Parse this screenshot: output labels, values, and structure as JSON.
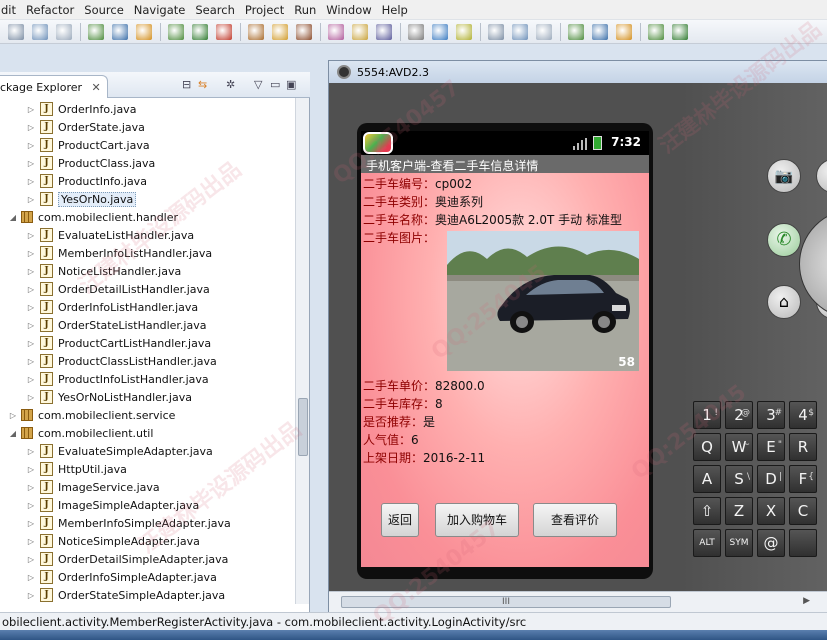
{
  "menu": [
    "dit",
    "Refactor",
    "Source",
    "Navigate",
    "Search",
    "Project",
    "Run",
    "Window",
    "Help"
  ],
  "explorer": {
    "tab_label": "ckage Explorer",
    "close": "✕",
    "tree": [
      {
        "type": "file",
        "name": "OrderInfo.java",
        "indent": 1
      },
      {
        "type": "file",
        "name": "OrderState.java",
        "indent": 1
      },
      {
        "type": "file",
        "name": "ProductCart.java",
        "indent": 1
      },
      {
        "type": "file",
        "name": "ProductClass.java",
        "indent": 1
      },
      {
        "type": "file",
        "name": "ProductInfo.java",
        "indent": 1
      },
      {
        "type": "file",
        "name": "YesOrNo.java",
        "indent": 1,
        "selected": true
      },
      {
        "type": "package",
        "name": "com.mobileclient.handler",
        "indent": 0,
        "expanded": true
      },
      {
        "type": "file",
        "name": "EvaluateListHandler.java",
        "indent": 1
      },
      {
        "type": "file",
        "name": "MemberInfoListHandler.java",
        "indent": 1
      },
      {
        "type": "file",
        "name": "NoticeListHandler.java",
        "indent": 1
      },
      {
        "type": "file",
        "name": "OrderDetailListHandler.java",
        "indent": 1
      },
      {
        "type": "file",
        "name": "OrderInfoListHandler.java",
        "indent": 1
      },
      {
        "type": "file",
        "name": "OrderStateListHandler.java",
        "indent": 1
      },
      {
        "type": "file",
        "name": "ProductCartListHandler.java",
        "indent": 1
      },
      {
        "type": "file",
        "name": "ProductClassListHandler.java",
        "indent": 1
      },
      {
        "type": "file",
        "name": "ProductInfoListHandler.java",
        "indent": 1
      },
      {
        "type": "file",
        "name": "YesOrNoListHandler.java",
        "indent": 1
      },
      {
        "type": "package",
        "name": "com.mobileclient.service",
        "indent": 0,
        "expanded": false
      },
      {
        "type": "package",
        "name": "com.mobileclient.util",
        "indent": 0,
        "expanded": true
      },
      {
        "type": "file",
        "name": "EvaluateSimpleAdapter.java",
        "indent": 1
      },
      {
        "type": "file",
        "name": "HttpUtil.java",
        "indent": 1
      },
      {
        "type": "file",
        "name": "ImageService.java",
        "indent": 1
      },
      {
        "type": "file",
        "name": "ImageSimpleAdapter.java",
        "indent": 1
      },
      {
        "type": "file",
        "name": "MemberInfoSimpleAdapter.java",
        "indent": 1
      },
      {
        "type": "file",
        "name": "NoticeSimpleAdapter.java",
        "indent": 1
      },
      {
        "type": "file",
        "name": "OrderDetailSimpleAdapter.java",
        "indent": 1
      },
      {
        "type": "file",
        "name": "OrderInfoSimpleAdapter.java",
        "indent": 1
      },
      {
        "type": "file",
        "name": "OrderStateSimpleAdapter.java",
        "indent": 1
      }
    ]
  },
  "status": {
    "text": "obileclient.activity.MemberRegisterActivity.java - com.mobileclient.activity.LoginActivity/src"
  },
  "emulator": {
    "window_title": "5554:AVD2.3",
    "hscroll_label": "III",
    "phone": {
      "time": "7:32",
      "app_title": "手机客户端-查看二手车信息详情",
      "fields": [
        {
          "label": "二手车编号：",
          "value": "cp002"
        },
        {
          "label": "二手车类别：",
          "value": "奥迪系列"
        },
        {
          "label": "二手车名称：",
          "value": "奥迪A6L2005款 2.0T 手动 标准型"
        },
        {
          "label": "二手车图片：",
          "value": ""
        }
      ],
      "image_watermark": "58",
      "fields2": [
        {
          "label": "二手车单价：",
          "value": "82800.0"
        },
        {
          "label": "二手车库存：",
          "value": "8"
        },
        {
          "label": "是否推荐：",
          "value": "是"
        },
        {
          "label": "人气值：",
          "value": "6"
        },
        {
          "label": "上架日期：",
          "value": "2016-2-11"
        }
      ],
      "buttons": {
        "back": "返回",
        "add_cart": "加入购物车",
        "view_eval": "查看评价"
      }
    },
    "keyboard": [
      {
        "k": "1",
        "a": "!"
      },
      {
        "k": "2",
        "a": "@"
      },
      {
        "k": "3",
        "a": "#"
      },
      {
        "k": "4",
        "a": "$"
      },
      {
        "k": "Q",
        "a": ""
      },
      {
        "k": "W",
        "a": "~"
      },
      {
        "k": "E",
        "a": "\""
      },
      {
        "k": "R",
        "a": ""
      },
      {
        "k": "A",
        "a": ""
      },
      {
        "k": "S",
        "a": "\\"
      },
      {
        "k": "D",
        "a": "|"
      },
      {
        "k": "F",
        "a": "{"
      },
      {
        "k": "⇧",
        "a": ""
      },
      {
        "k": "Z",
        "a": ""
      },
      {
        "k": "X",
        "a": ""
      },
      {
        "k": "C",
        "a": ""
      },
      {
        "k": "ALT",
        "a": ""
      },
      {
        "k": "SYM",
        "a": ""
      },
      {
        "k": "@",
        "a": ""
      },
      {
        "k": "",
        "a": ""
      }
    ],
    "ctrl_partial": "M"
  },
  "watermarks": [
    "QQ:2540457",
    "汪建林毕设源码出品",
    "QQ:254045",
    "汪建林毕设源码出品",
    "QQ:2540457",
    "汪建林毕设源码出品",
    "QQ:254045"
  ],
  "colors": {
    "label": "#8e0000",
    "accent_pink": "#fa8f97",
    "title_bar": "#6a6a6a"
  }
}
